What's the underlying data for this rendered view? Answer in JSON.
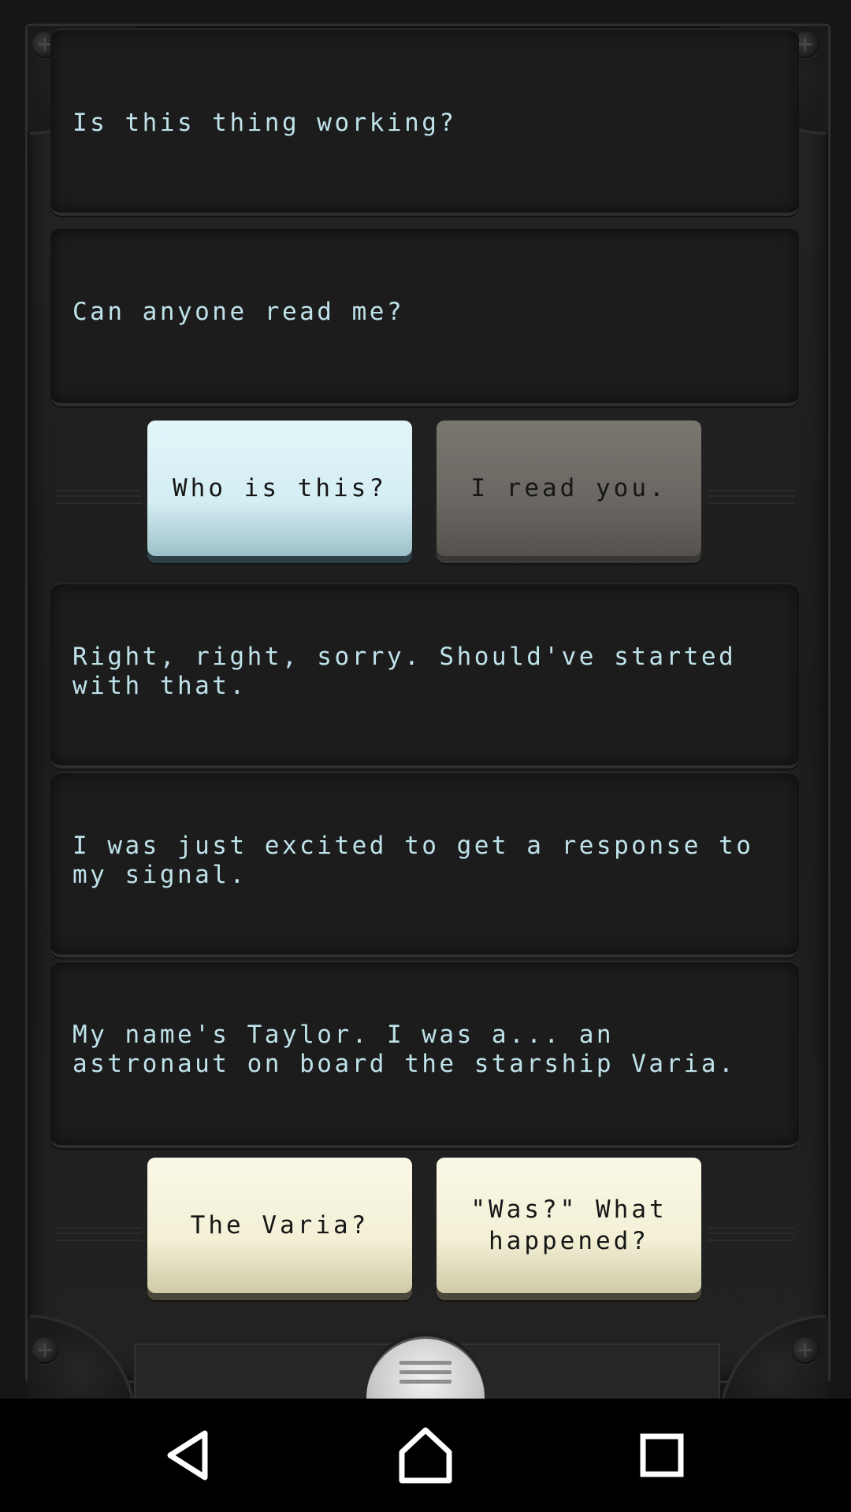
{
  "messages": [
    {
      "text": "Is this thing working?"
    },
    {
      "text": "Can anyone read me?"
    },
    {
      "text": "Right, right, sorry. Should've started\nwith that."
    },
    {
      "text": "I was just excited to get a response to\nmy signal."
    },
    {
      "text": "My name's Taylor. I was a... an\nastronaut on board the starship Varia."
    }
  ],
  "choices_1": {
    "left": {
      "label": "Who is this?",
      "state": "selected"
    },
    "right": {
      "label": "I read you.",
      "state": "dimmed"
    }
  },
  "choices_2": {
    "left": {
      "label": "The Varia?",
      "state": "available"
    },
    "right": {
      "label": "\"Was?\" What\nhappened?",
      "state": "available"
    }
  },
  "menu": {
    "icon": "hamburger-icon"
  },
  "nav": {
    "back": "back-icon",
    "home": "home-icon",
    "recents": "recents-icon"
  },
  "colors": {
    "message_text": "#bfe2ea",
    "selected_choice": "#d4eef3",
    "dimmed_choice": "#6a6762",
    "available_choice": "#f3f0d6"
  }
}
